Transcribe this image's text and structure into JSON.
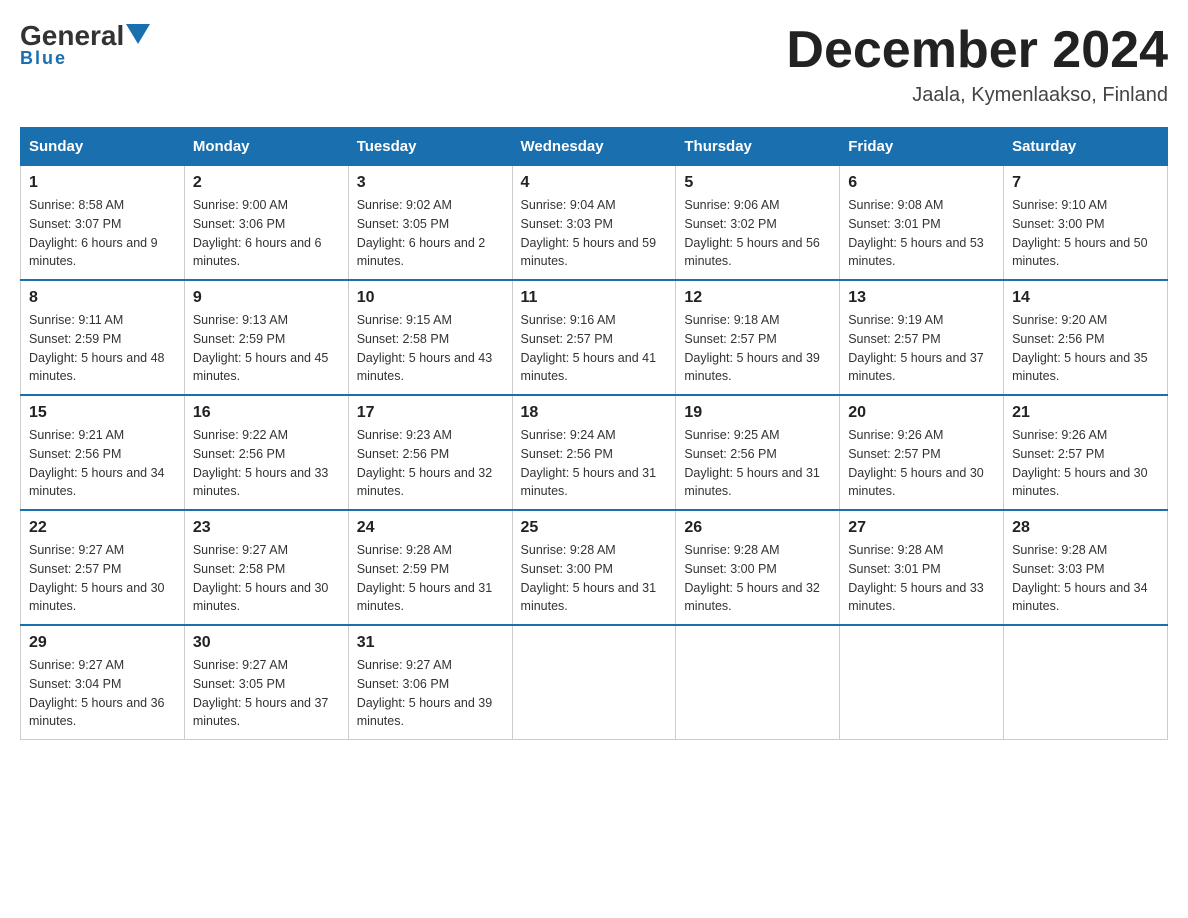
{
  "logo": {
    "general": "General",
    "blue": "Blue",
    "underline": "Blue"
  },
  "title": {
    "month": "December 2024",
    "location": "Jaala, Kymenlaakso, Finland"
  },
  "days_of_week": [
    "Sunday",
    "Monday",
    "Tuesday",
    "Wednesday",
    "Thursday",
    "Friday",
    "Saturday"
  ],
  "weeks": [
    [
      {
        "day": "1",
        "sunrise": "Sunrise: 8:58 AM",
        "sunset": "Sunset: 3:07 PM",
        "daylight": "Daylight: 6 hours and 9 minutes."
      },
      {
        "day": "2",
        "sunrise": "Sunrise: 9:00 AM",
        "sunset": "Sunset: 3:06 PM",
        "daylight": "Daylight: 6 hours and 6 minutes."
      },
      {
        "day": "3",
        "sunrise": "Sunrise: 9:02 AM",
        "sunset": "Sunset: 3:05 PM",
        "daylight": "Daylight: 6 hours and 2 minutes."
      },
      {
        "day": "4",
        "sunrise": "Sunrise: 9:04 AM",
        "sunset": "Sunset: 3:03 PM",
        "daylight": "Daylight: 5 hours and 59 minutes."
      },
      {
        "day": "5",
        "sunrise": "Sunrise: 9:06 AM",
        "sunset": "Sunset: 3:02 PM",
        "daylight": "Daylight: 5 hours and 56 minutes."
      },
      {
        "day": "6",
        "sunrise": "Sunrise: 9:08 AM",
        "sunset": "Sunset: 3:01 PM",
        "daylight": "Daylight: 5 hours and 53 minutes."
      },
      {
        "day": "7",
        "sunrise": "Sunrise: 9:10 AM",
        "sunset": "Sunset: 3:00 PM",
        "daylight": "Daylight: 5 hours and 50 minutes."
      }
    ],
    [
      {
        "day": "8",
        "sunrise": "Sunrise: 9:11 AM",
        "sunset": "Sunset: 2:59 PM",
        "daylight": "Daylight: 5 hours and 48 minutes."
      },
      {
        "day": "9",
        "sunrise": "Sunrise: 9:13 AM",
        "sunset": "Sunset: 2:59 PM",
        "daylight": "Daylight: 5 hours and 45 minutes."
      },
      {
        "day": "10",
        "sunrise": "Sunrise: 9:15 AM",
        "sunset": "Sunset: 2:58 PM",
        "daylight": "Daylight: 5 hours and 43 minutes."
      },
      {
        "day": "11",
        "sunrise": "Sunrise: 9:16 AM",
        "sunset": "Sunset: 2:57 PM",
        "daylight": "Daylight: 5 hours and 41 minutes."
      },
      {
        "day": "12",
        "sunrise": "Sunrise: 9:18 AM",
        "sunset": "Sunset: 2:57 PM",
        "daylight": "Daylight: 5 hours and 39 minutes."
      },
      {
        "day": "13",
        "sunrise": "Sunrise: 9:19 AM",
        "sunset": "Sunset: 2:57 PM",
        "daylight": "Daylight: 5 hours and 37 minutes."
      },
      {
        "day": "14",
        "sunrise": "Sunrise: 9:20 AM",
        "sunset": "Sunset: 2:56 PM",
        "daylight": "Daylight: 5 hours and 35 minutes."
      }
    ],
    [
      {
        "day": "15",
        "sunrise": "Sunrise: 9:21 AM",
        "sunset": "Sunset: 2:56 PM",
        "daylight": "Daylight: 5 hours and 34 minutes."
      },
      {
        "day": "16",
        "sunrise": "Sunrise: 9:22 AM",
        "sunset": "Sunset: 2:56 PM",
        "daylight": "Daylight: 5 hours and 33 minutes."
      },
      {
        "day": "17",
        "sunrise": "Sunrise: 9:23 AM",
        "sunset": "Sunset: 2:56 PM",
        "daylight": "Daylight: 5 hours and 32 minutes."
      },
      {
        "day": "18",
        "sunrise": "Sunrise: 9:24 AM",
        "sunset": "Sunset: 2:56 PM",
        "daylight": "Daylight: 5 hours and 31 minutes."
      },
      {
        "day": "19",
        "sunrise": "Sunrise: 9:25 AM",
        "sunset": "Sunset: 2:56 PM",
        "daylight": "Daylight: 5 hours and 31 minutes."
      },
      {
        "day": "20",
        "sunrise": "Sunrise: 9:26 AM",
        "sunset": "Sunset: 2:57 PM",
        "daylight": "Daylight: 5 hours and 30 minutes."
      },
      {
        "day": "21",
        "sunrise": "Sunrise: 9:26 AM",
        "sunset": "Sunset: 2:57 PM",
        "daylight": "Daylight: 5 hours and 30 minutes."
      }
    ],
    [
      {
        "day": "22",
        "sunrise": "Sunrise: 9:27 AM",
        "sunset": "Sunset: 2:57 PM",
        "daylight": "Daylight: 5 hours and 30 minutes."
      },
      {
        "day": "23",
        "sunrise": "Sunrise: 9:27 AM",
        "sunset": "Sunset: 2:58 PM",
        "daylight": "Daylight: 5 hours and 30 minutes."
      },
      {
        "day": "24",
        "sunrise": "Sunrise: 9:28 AM",
        "sunset": "Sunset: 2:59 PM",
        "daylight": "Daylight: 5 hours and 31 minutes."
      },
      {
        "day": "25",
        "sunrise": "Sunrise: 9:28 AM",
        "sunset": "Sunset: 3:00 PM",
        "daylight": "Daylight: 5 hours and 31 minutes."
      },
      {
        "day": "26",
        "sunrise": "Sunrise: 9:28 AM",
        "sunset": "Sunset: 3:00 PM",
        "daylight": "Daylight: 5 hours and 32 minutes."
      },
      {
        "day": "27",
        "sunrise": "Sunrise: 9:28 AM",
        "sunset": "Sunset: 3:01 PM",
        "daylight": "Daylight: 5 hours and 33 minutes."
      },
      {
        "day": "28",
        "sunrise": "Sunrise: 9:28 AM",
        "sunset": "Sunset: 3:03 PM",
        "daylight": "Daylight: 5 hours and 34 minutes."
      }
    ],
    [
      {
        "day": "29",
        "sunrise": "Sunrise: 9:27 AM",
        "sunset": "Sunset: 3:04 PM",
        "daylight": "Daylight: 5 hours and 36 minutes."
      },
      {
        "day": "30",
        "sunrise": "Sunrise: 9:27 AM",
        "sunset": "Sunset: 3:05 PM",
        "daylight": "Daylight: 5 hours and 37 minutes."
      },
      {
        "day": "31",
        "sunrise": "Sunrise: 9:27 AM",
        "sunset": "Sunset: 3:06 PM",
        "daylight": "Daylight: 5 hours and 39 minutes."
      },
      null,
      null,
      null,
      null
    ]
  ]
}
